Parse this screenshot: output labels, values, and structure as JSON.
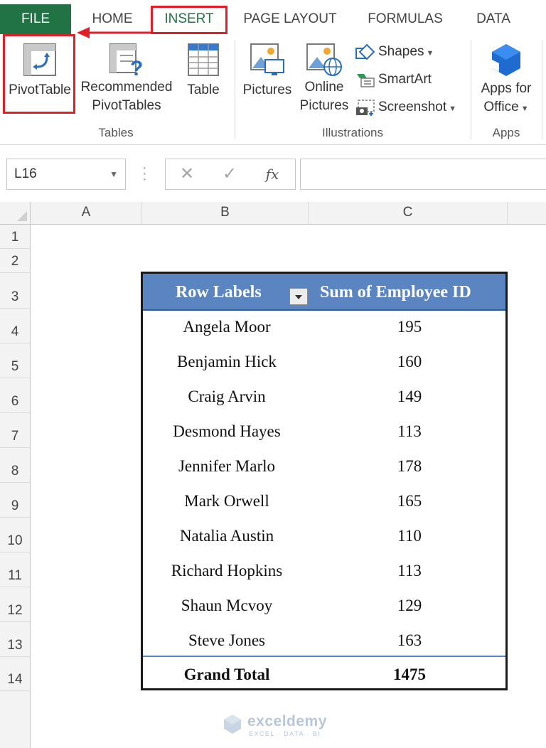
{
  "ribbon_tabs": [
    "FILE",
    "HOME",
    "INSERT",
    "PAGE LAYOUT",
    "FORMULAS",
    "DATA"
  ],
  "tables_group": {
    "label": "Tables",
    "pivot_table": "PivotTable",
    "recommended_line1": "Recommended",
    "recommended_line2": "PivotTables",
    "table": "Table"
  },
  "illustrations_group": {
    "label": "Illustrations",
    "pictures": "Pictures",
    "online_line1": "Online",
    "online_line2": "Pictures",
    "shapes": "Shapes",
    "smartart": "SmartArt",
    "screenshot": "Screenshot"
  },
  "apps_group": {
    "label": "Apps",
    "apps_line1": "Apps for",
    "apps_line2": "Office"
  },
  "formula_bar": {
    "name_box": "L16",
    "cancel_glyph": "✕",
    "enter_glyph": "✓",
    "fx_label": "fx",
    "formula": ""
  },
  "columns": [
    "A",
    "B",
    "C"
  ],
  "rows": [
    "1",
    "2",
    "3",
    "4",
    "5",
    "6",
    "7",
    "8",
    "9",
    "10",
    "11",
    "12",
    "13",
    "14"
  ],
  "pivot": {
    "header_row_labels": "Row Labels",
    "header_value": "Sum of Employee ID",
    "rows": [
      {
        "name": "Angela Moor",
        "value": "195"
      },
      {
        "name": "Benjamin Hick",
        "value": "160"
      },
      {
        "name": "Craig Arvin",
        "value": "149"
      },
      {
        "name": "Desmond Hayes",
        "value": "113"
      },
      {
        "name": "Jennifer Marlo",
        "value": "178"
      },
      {
        "name": "Mark Orwell",
        "value": "165"
      },
      {
        "name": "Natalia Austin",
        "value": "110"
      },
      {
        "name": "Richard Hopkins",
        "value": "113"
      },
      {
        "name": "Shaun Mcvoy",
        "value": "129"
      },
      {
        "name": "Steve Jones",
        "value": "163"
      }
    ],
    "grand_total_label": "Grand Total",
    "grand_total_value": "1475"
  },
  "watermark": {
    "brand": "exceldemy",
    "tagline": "EXCEL · DATA · BI"
  },
  "colors": {
    "file_tab": "#217346",
    "insert_tab_text": "#217346",
    "highlight": "#e41e26",
    "pivot_header": "#5b85c0"
  },
  "icons": [
    "pivottable-icon",
    "recommended-pivottables-icon",
    "table-icon",
    "pictures-icon",
    "online-pictures-icon",
    "shapes-icon",
    "smartart-icon",
    "screenshot-icon",
    "apps-for-office-icon"
  ]
}
